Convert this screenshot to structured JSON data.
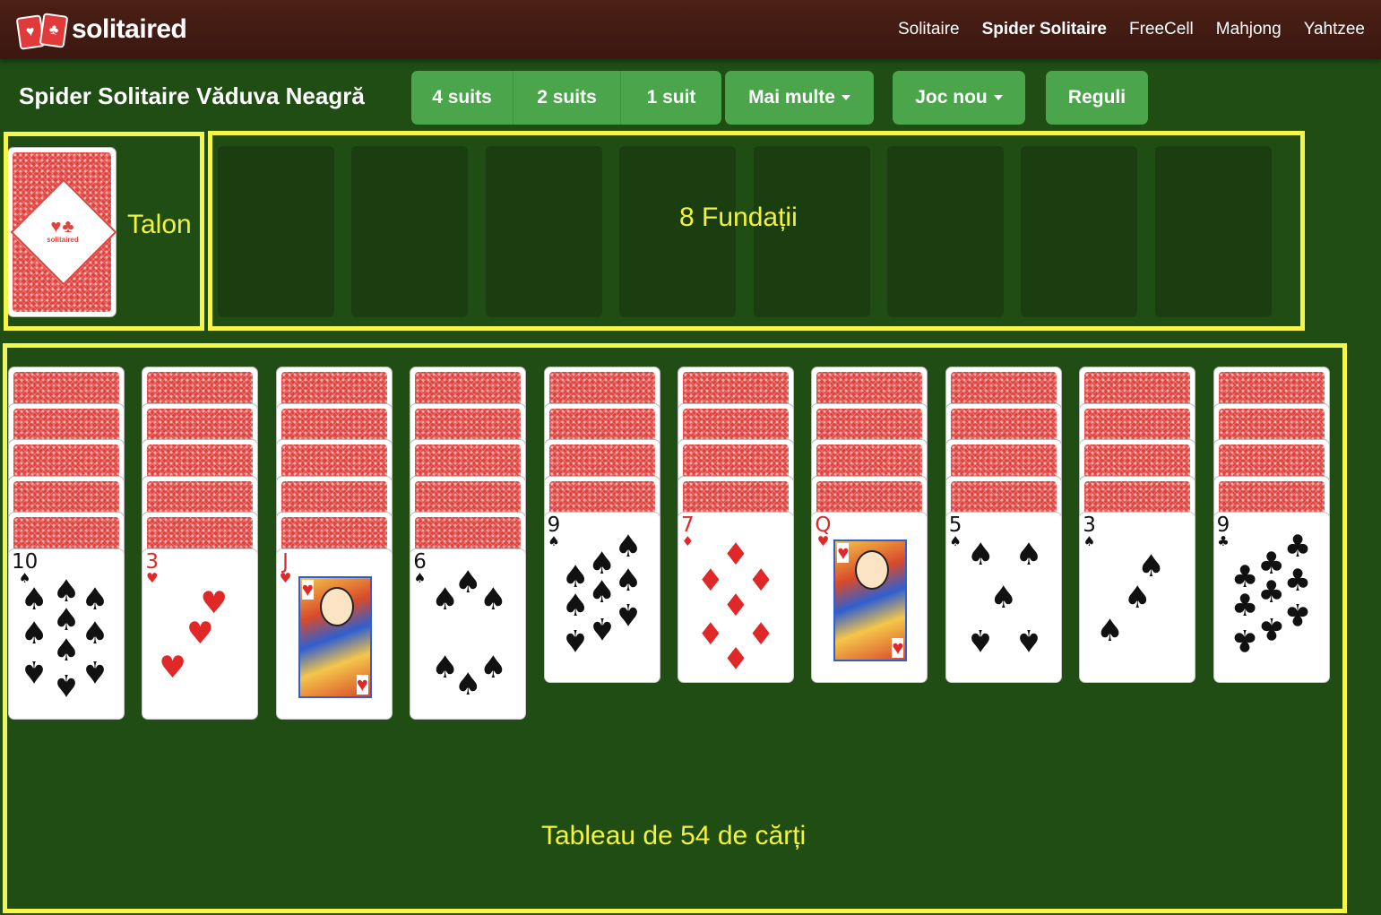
{
  "navbar": {
    "logo_text": "solitaired",
    "links": [
      "Solitaire",
      "Spider Solitaire",
      "FreeCell",
      "Mahjong",
      "Yahtzee"
    ],
    "active_link": "Spider Solitaire"
  },
  "toolbar": {
    "title": "Spider Solitaire Văduva Neagră",
    "suit_buttons": [
      "4 suits",
      "2 suits",
      "1 suit"
    ],
    "more_label": "Mai multe",
    "new_game_label": "Joc nou",
    "rules_label": "Reguli"
  },
  "zones": {
    "talon_label": "Talon",
    "foundations_label": "8 Fundații",
    "tableau_label": "Tableau de 54 de cărți",
    "outline_color": "#f5f54a"
  },
  "talon_card": {
    "logo_text": "solitaired"
  },
  "foundations": {
    "count": 8
  },
  "tableau": {
    "columns": [
      {
        "facedown": 5,
        "top": {
          "rank": "10",
          "suit": "♠",
          "color": "black"
        }
      },
      {
        "facedown": 5,
        "top": {
          "rank": "3",
          "suit": "♥",
          "color": "red"
        }
      },
      {
        "facedown": 5,
        "top": {
          "rank": "J",
          "suit": "♥",
          "color": "red"
        }
      },
      {
        "facedown": 5,
        "top": {
          "rank": "6",
          "suit": "♠",
          "color": "black"
        }
      },
      {
        "facedown": 4,
        "top": {
          "rank": "9",
          "suit": "♠",
          "color": "black"
        }
      },
      {
        "facedown": 4,
        "top": {
          "rank": "7",
          "suit": "♦",
          "color": "red"
        }
      },
      {
        "facedown": 4,
        "top": {
          "rank": "Q",
          "suit": "♥",
          "color": "red"
        }
      },
      {
        "facedown": 4,
        "top": {
          "rank": "5",
          "suit": "♠",
          "color": "black"
        }
      },
      {
        "facedown": 4,
        "top": {
          "rank": "3",
          "suit": "♠",
          "color": "black"
        }
      },
      {
        "facedown": 4,
        "top": {
          "rank": "9",
          "suit": "♣",
          "color": "black"
        }
      }
    ]
  },
  "colors": {
    "felt": "#1f4d14",
    "navbar": "#3f1a11",
    "button": "#4ba64b",
    "card_back": "#e0433f",
    "label": "#f3f33c"
  }
}
